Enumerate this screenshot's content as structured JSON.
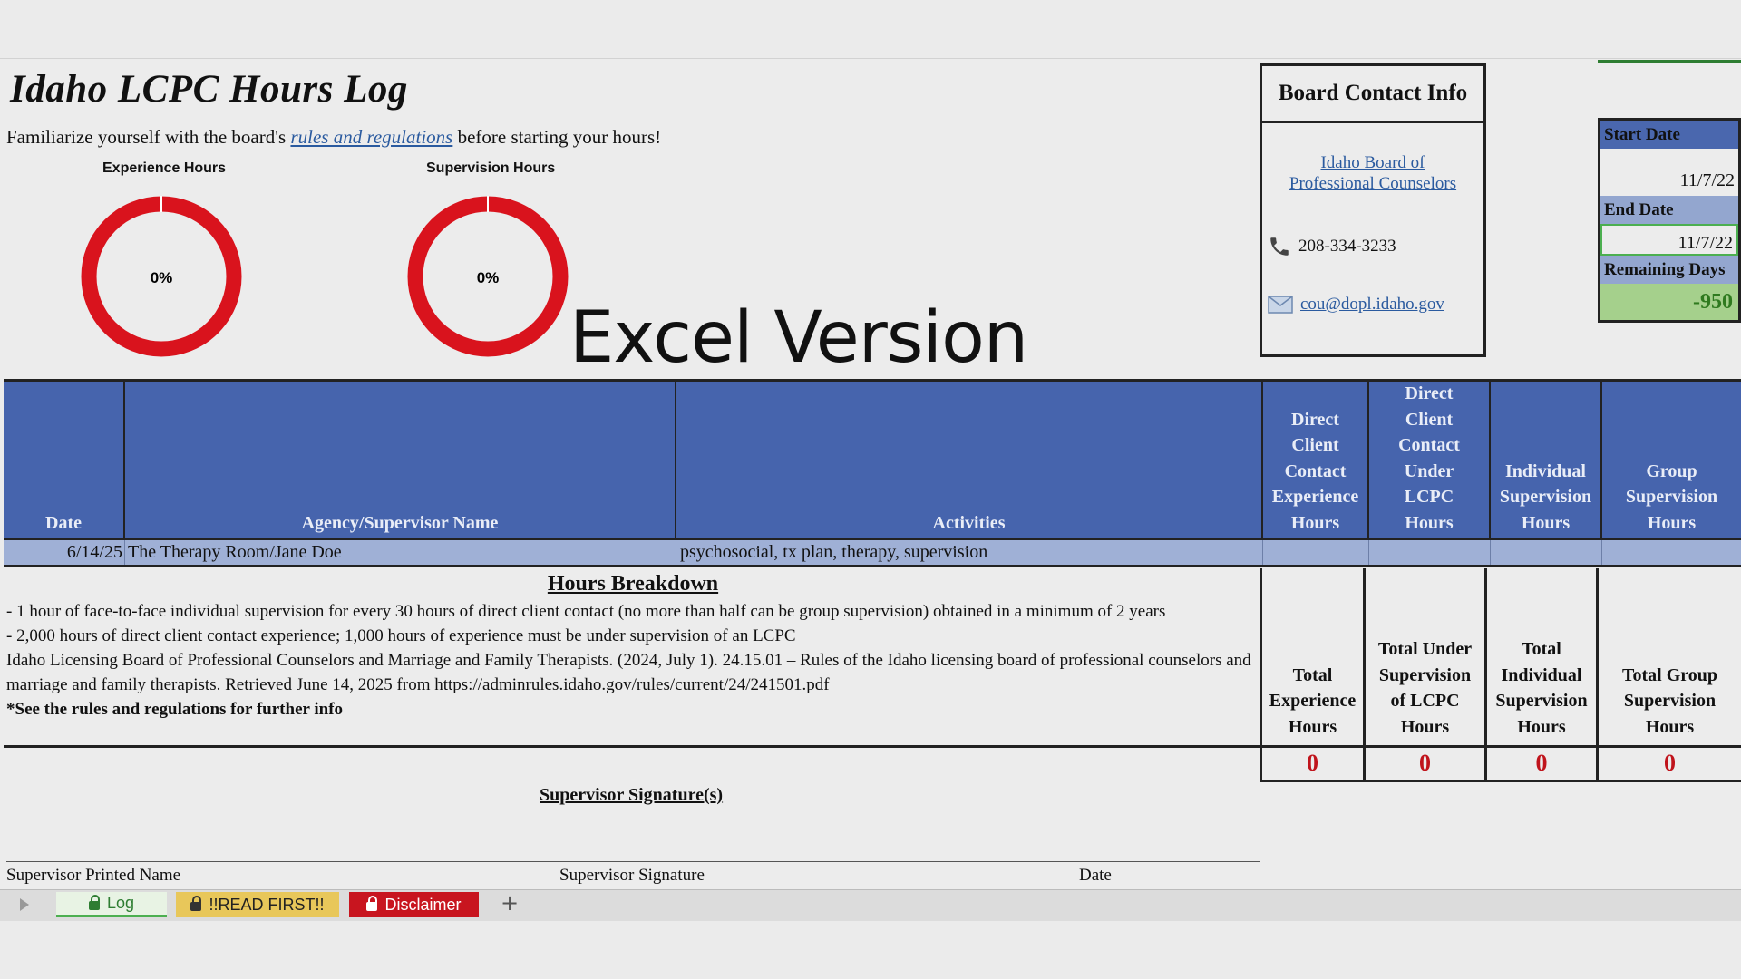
{
  "title": "Idaho LCPC Hours Log",
  "intro": {
    "before": "Familiarize yourself with the board's",
    "link": "rules and regulations",
    "after": "before starting your hours!"
  },
  "charts": {
    "experience": {
      "label": "Experience Hours",
      "value_text": "0%",
      "progress": 0
    },
    "supervision": {
      "label": "Supervision Hours",
      "value_text": "0%",
      "progress": 0
    }
  },
  "watermark": "Excel Version",
  "contact": {
    "heading": "Board Contact Info",
    "board_link_line1": "Idaho Board of",
    "board_link_line2": "Professional Counselors",
    "phone": "208-334-3233",
    "email": "cou@dopl.idaho.gov",
    "phone_icon": "phone-icon",
    "email_icon": "email-icon"
  },
  "dates": {
    "start_label": "Start Date",
    "start_value": "11/7/22",
    "end_label": "End Date",
    "end_value": "11/7/22",
    "remaining_label": "Remaining Days",
    "remaining_value": "-950"
  },
  "table": {
    "headers": [
      "Date",
      "Agency/Supervisor Name",
      "Activities",
      "Direct Client Contact Experience Hours",
      "Direct Client Contact Under LCPC Hours",
      "Individual Supervision Hours",
      "Group Supervision Hours"
    ],
    "rows": [
      [
        "6/14/25",
        "The Therapy Room/Jane Doe",
        "psychosocial, tx plan, therapy, supervision",
        "",
        "",
        "",
        ""
      ]
    ]
  },
  "breakdown": {
    "heading": "Hours Breakdown",
    "line1": "- 1 hour of face-to-face individual supervision for every 30 hours of direct client contact (no more than half can be group supervision) obtained in a minimum of 2 years",
    "line2": "- 2,000 hours of direct client contact experience; 1,000 hours of experience must be under supervision of an LCPC",
    "line3": "Idaho Licensing Board of Professional Counselors and Marriage and Family Therapists. (2024, July 1). 24.15.01 – Rules of the Idaho licensing board of professional counselors and marriage and family therapists. Retrieved June 14, 2025 from https://adminrules.idaho.gov/rules/current/24/241501.pdf",
    "line4": "*See the rules and regulations for further info"
  },
  "totals": {
    "headers": [
      "Total Experience Hours",
      "Total Under Supervision of LCPC Hours",
      "Total Individual Supervision Hours",
      "Total Group Supervision Hours"
    ],
    "values": [
      "0",
      "0",
      "0",
      "0"
    ]
  },
  "signature": {
    "title": "Supervisor Signature(s)",
    "printed_name": "Supervisor Printed Name",
    "signature": "Supervisor Signature",
    "date": "Date"
  },
  "tabs": {
    "log": "Log",
    "read_first": "!!READ FIRST!!",
    "disclaimer": "Disclaimer",
    "add": "+"
  },
  "colors": {
    "header_blue": "#4664ad",
    "row_blue": "#9fb0d6",
    "donut_red": "#d9131d",
    "total_red": "#c0141c",
    "remaining_green": "#a5d08c"
  }
}
